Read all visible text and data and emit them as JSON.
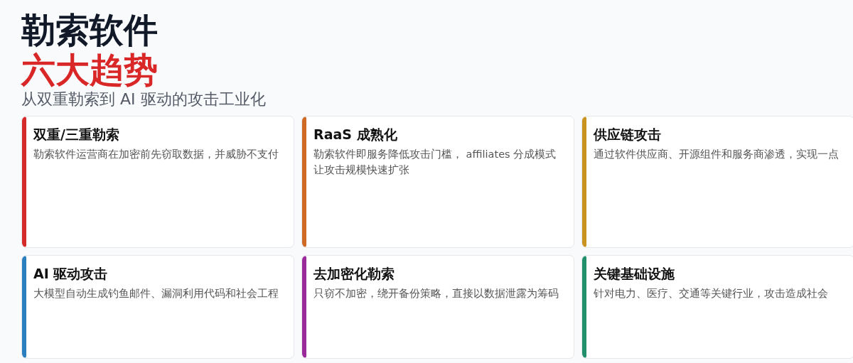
{
  "header": {
    "title": "勒索软件",
    "highlight": "六大趋势",
    "subtitle": "从双重勒索到 AI 驱动的攻击工业化"
  },
  "cards": [
    {
      "title": "双重/三重勒索",
      "description": "勒索软件运营商在加密前先窃取数据，并威胁不支付",
      "color": "#d62a2a"
    },
    {
      "title": "RaaS 成熟化",
      "description": "勒索软件即服务降低攻击门槛， affiliates 分成模式让攻击规模快速扩张",
      "color": "#cf6a25"
    },
    {
      "title": "供应链攻击",
      "description": "通过软件供应商、开源组件和服务商渗透，实现一点",
      "color": "#c9931f"
    },
    {
      "title": "AI 驱动攻击",
      "description": "大模型自动生成钓鱼邮件、漏洞利用代码和社会工程",
      "color": "#2b7fbf"
    },
    {
      "title": "去加密化勒索",
      "description": "只窃不加密，绕开备份策略，直接以数据泄露为筹码",
      "color": "#9a2a9a"
    },
    {
      "title": "关键基础设施",
      "description": "针对电力、医疗、交通等关键行业，攻击造成社会",
      "color": "#1f8f6c"
    }
  ]
}
